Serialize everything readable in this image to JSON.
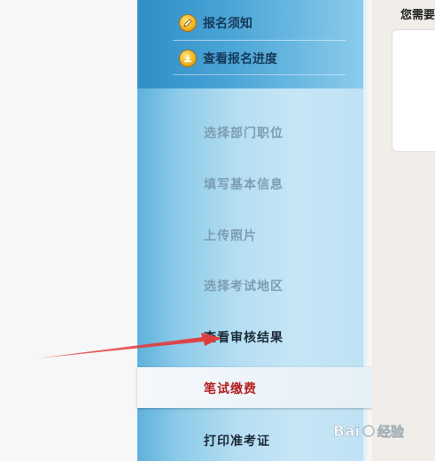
{
  "top_links": [
    {
      "label": "报名须知",
      "icon": "pencil-icon"
    },
    {
      "label": "查看报名进度",
      "icon": "download-icon"
    }
  ],
  "steps": [
    {
      "label": "选择部门职位",
      "state": "disabled"
    },
    {
      "label": "填写基本信息",
      "state": "disabled"
    },
    {
      "label": "上传照片",
      "state": "disabled"
    },
    {
      "label": "选择考试地区",
      "state": "disabled"
    },
    {
      "label": "查看审核结果",
      "state": "active"
    },
    {
      "label": "笔试缴费",
      "state": "current"
    },
    {
      "label": "打印准考证",
      "state": "active"
    }
  ],
  "right_panel": {
    "notice_label": "您需要"
  },
  "colors": {
    "sidebar_top": "#2f8ec6",
    "sidebar_body": "#b6def2",
    "current_text": "#b51f1f",
    "arrow": "#e23b3b"
  },
  "watermark": {
    "text": "Bai经验"
  }
}
